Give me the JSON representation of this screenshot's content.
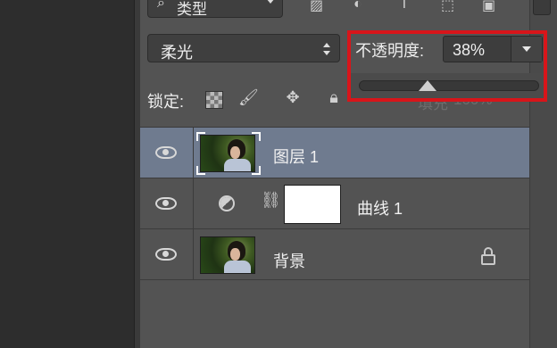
{
  "filter_row": {
    "kind_label": "类型",
    "search_icon": "search-icon"
  },
  "blend": {
    "mode": "柔光"
  },
  "opacity": {
    "label": "不透明度:",
    "value": "38%",
    "level": 0.38
  },
  "lock": {
    "label": "锁定:",
    "fill_label": "填充",
    "fill_value": "100%"
  },
  "layers": [
    {
      "name": "图层 1",
      "selected": true,
      "visible": true
    },
    {
      "name": "曲线 1",
      "selected": false,
      "visible": true
    },
    {
      "name": "背景",
      "selected": false,
      "visible": true,
      "locked": true
    }
  ],
  "colors": {
    "highlight": "#d8151a",
    "selected_row": "#6f7b8f",
    "panel": "#535353"
  }
}
